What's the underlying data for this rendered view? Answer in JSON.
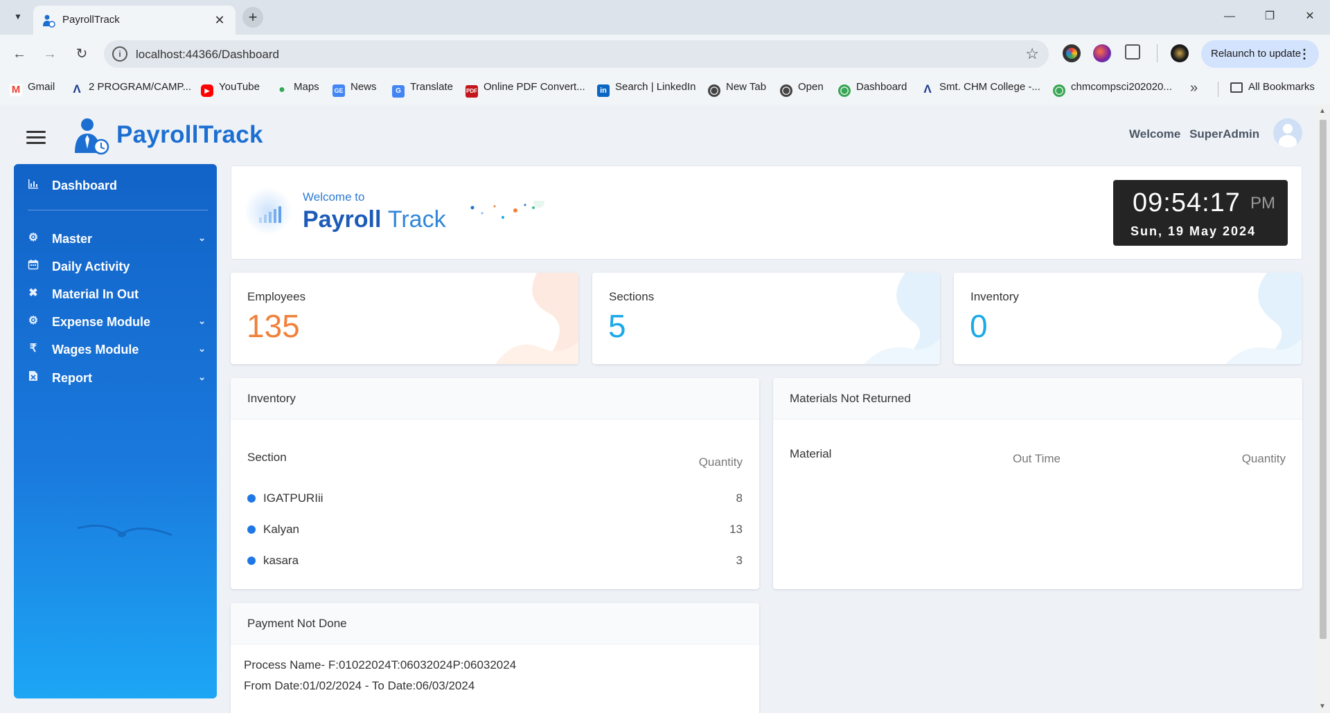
{
  "browser": {
    "tab_title": "PayrollTrack",
    "url": "localhost:44366/Dashboard",
    "relaunch_label": "Relaunch to update",
    "bookmarks": [
      {
        "label": "Gmail",
        "icon": "gmail-icon",
        "color": "#ea4335"
      },
      {
        "label": "2 PROGRAM/CAMP...",
        "icon": "a-logo-icon",
        "color": "#1a3d8f"
      },
      {
        "label": "YouTube",
        "icon": "youtube-icon",
        "color": "#ff0000"
      },
      {
        "label": "Maps",
        "icon": "maps-icon",
        "color": "#34a853"
      },
      {
        "label": "News",
        "icon": "news-icon",
        "color": "#4285f4"
      },
      {
        "label": "Translate",
        "icon": "translate-icon",
        "color": "#4285f4"
      },
      {
        "label": "Online PDF Convert...",
        "icon": "pdf-icon",
        "color": "#c4161c"
      },
      {
        "label": "Search | LinkedIn",
        "icon": "linkedin-icon",
        "color": "#0a66c2"
      },
      {
        "label": "New Tab",
        "icon": "globe-icon",
        "color": "#444444"
      },
      {
        "label": "Open",
        "icon": "globe-icon",
        "color": "#444444"
      },
      {
        "label": "Dashboard",
        "icon": "globe-icon",
        "color": "#3aa655"
      },
      {
        "label": "Smt. CHM College -...",
        "icon": "a-logo-icon",
        "color": "#1a3d8f"
      },
      {
        "label": "chmcompsci202020...",
        "icon": "globe-icon",
        "color": "#3aa655"
      }
    ],
    "all_bookmarks_label": "All Bookmarks"
  },
  "header": {
    "brand": "PayrollTrack",
    "welcome_label": "Welcome",
    "user_name": "SuperAdmin"
  },
  "sidebar": {
    "items": [
      {
        "label": "Dashboard",
        "icon": "bar-chart-icon",
        "has_submenu": false
      },
      {
        "label": "Master",
        "icon": "gear-icon",
        "has_submenu": true
      },
      {
        "label": "Daily Activity",
        "icon": "calendar-icon",
        "has_submenu": false
      },
      {
        "label": "Material In Out",
        "icon": "tools-icon",
        "has_submenu": false
      },
      {
        "label": "Expense Module",
        "icon": "gear-icon",
        "has_submenu": true
      },
      {
        "label": "Wages Module",
        "icon": "rupee-icon",
        "has_submenu": true
      },
      {
        "label": "Report",
        "icon": "report-icon",
        "has_submenu": true
      }
    ]
  },
  "banner": {
    "welcome_to": "Welcome to",
    "title_bold": "Payroll",
    "title_light": "Track"
  },
  "clock": {
    "time": "09:54:17",
    "ampm": "PM",
    "date": "Sun, 19 May 2024"
  },
  "stats": [
    {
      "title": "Employees",
      "value": "135",
      "color": "#f0813a"
    },
    {
      "title": "Sections",
      "value": "5",
      "color": "#1ba9e8"
    },
    {
      "title": "Inventory",
      "value": "0",
      "color": "#1ba9e8"
    }
  ],
  "inventory_panel": {
    "title": "Inventory",
    "col_section": "Section",
    "col_quantity": "Quantity",
    "rows": [
      {
        "section": "IGATPURIii",
        "quantity": "8"
      },
      {
        "section": "Kalyan",
        "quantity": "13"
      },
      {
        "section": "kasara",
        "quantity": "3"
      }
    ]
  },
  "materials_panel": {
    "title": "Materials Not Returned",
    "col_material": "Material",
    "col_out_time": "Out Time",
    "col_quantity": "Quantity"
  },
  "payment_panel": {
    "title": "Payment Not Done",
    "process_line": "Process Name- F:01022024T:06032024P:06032024",
    "date_line": "From Date:01/02/2024 - To Date:06/03/2024"
  },
  "colors": {
    "accent": "#1c6fd1",
    "sidebar_top": "#1263c7",
    "sidebar_bottom": "#1da6f5",
    "dot": "#1f77e6"
  }
}
